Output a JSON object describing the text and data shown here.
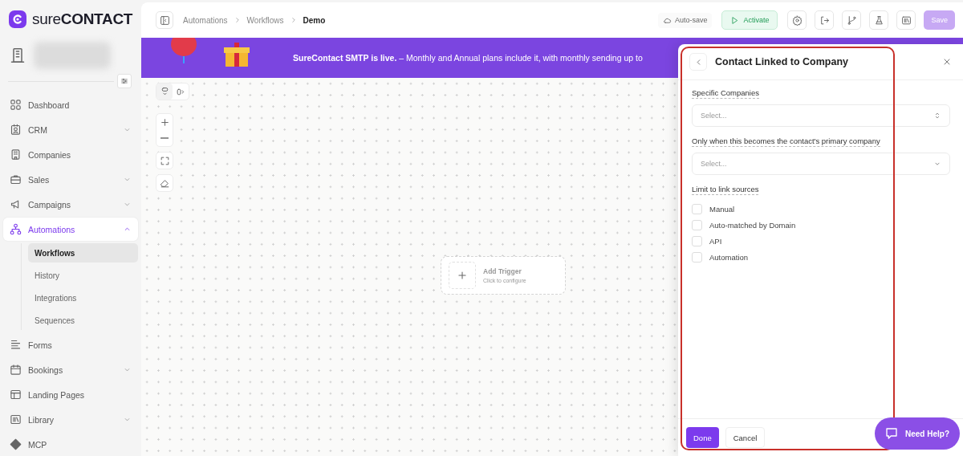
{
  "brand": {
    "logo": "sure**CONTACT**"
  },
  "sidebar": {
    "items": [
      {
        "label": "Dashboard",
        "kind": "link",
        "selected": false
      },
      {
        "label": "CRM",
        "kind": "group",
        "expanded": false,
        "selected": false
      },
      {
        "label": "Companies",
        "kind": "link",
        "selected": false
      },
      {
        "label": "Sales",
        "kind": "group",
        "expanded": false,
        "selected": false
      },
      {
        "label": "Campaigns",
        "kind": "group",
        "expanded": false,
        "selected": false
      },
      {
        "label": "Automations",
        "kind": "group",
        "expanded": true,
        "selected": true,
        "children": [
          {
            "label": "Workflows",
            "selected": true
          },
          {
            "label": "History",
            "selected": false
          },
          {
            "label": "Integrations",
            "selected": false
          },
          {
            "label": "Sequences",
            "selected": false
          }
        ]
      },
      {
        "label": "Forms",
        "kind": "link",
        "selected": false
      },
      {
        "label": "Bookings",
        "kind": "group",
        "expanded": false,
        "selected": false
      },
      {
        "label": "Landing Pages",
        "kind": "link",
        "selected": false
      },
      {
        "label": "Library",
        "kind": "group",
        "expanded": false,
        "selected": false
      },
      {
        "label": "MCP",
        "kind": "link",
        "selected": false
      }
    ]
  },
  "breadcrumbs": [
    "Automations",
    "Workflows",
    "Demo"
  ],
  "toolbar": {
    "autosave": "Auto-save",
    "activate": "Activate",
    "save": {
      "label": "Save",
      "disabled": true
    }
  },
  "banner": {
    "text": "**SureContact SMTP is live.** – Monthly and Annual plans include it, with monthly sending up to"
  },
  "canvas": {
    "layout": [
      {
        "selected": true
      },
      {
        "selected": false
      }
    ],
    "trigger": {
      "title": "Add Trigger",
      "subtitle": "Click to configure"
    }
  },
  "panel": {
    "title": "Contact Linked to Company",
    "fields": [
      {
        "label": "Specific Companies",
        "placeholder": "Select...",
        "kind": "combobox"
      },
      {
        "label": "Only when this becomes the contact's primary company",
        "placeholder": "Select...",
        "kind": "dropdown"
      }
    ],
    "sources": {
      "label": "Limit to link sources",
      "options": [
        {
          "label": "Manual",
          "checked": false
        },
        {
          "label": "Auto-matched by Domain",
          "checked": false
        },
        {
          "label": "API",
          "checked": false
        },
        {
          "label": "Automation",
          "checked": false
        }
      ]
    },
    "buttons": {
      "done": "Done",
      "cancel": "Cancel"
    }
  },
  "help": {
    "label": "Need Help?"
  }
}
